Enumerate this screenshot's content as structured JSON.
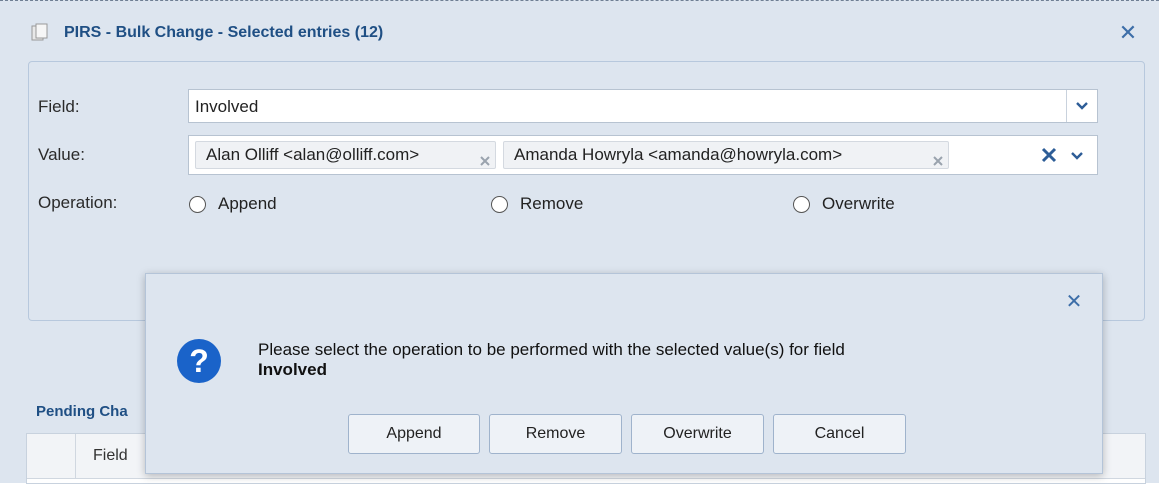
{
  "window": {
    "title": "PIRS - Bulk Change - Selected entries (12)",
    "title_icon": "copy-documents-icon",
    "close_icon": "close-icon"
  },
  "form": {
    "field_label": "Field:",
    "field_value": "Involved",
    "value_label": "Value:",
    "value_tags": [
      "Alan Olliff <alan@olliff.com>",
      "Amanda Howryla <amanda@howryla.com>"
    ],
    "operation_label": "Operation:",
    "operations": [
      "Append",
      "Remove",
      "Overwrite"
    ]
  },
  "pending": {
    "title": "Pending Cha",
    "col_field": "Field"
  },
  "dialog": {
    "message": "Please select the operation to be performed with the selected value(s) for field",
    "field_name": "Involved",
    "icon": "question-icon",
    "buttons": {
      "append": "Append",
      "remove": "Remove",
      "overwrite": "Overwrite",
      "cancel": "Cancel"
    }
  },
  "colors": {
    "title": "#1f4f84",
    "panel_bg": "#dde5ef",
    "accent": "#3d6ea8",
    "question_icon": "#1a63c9"
  }
}
